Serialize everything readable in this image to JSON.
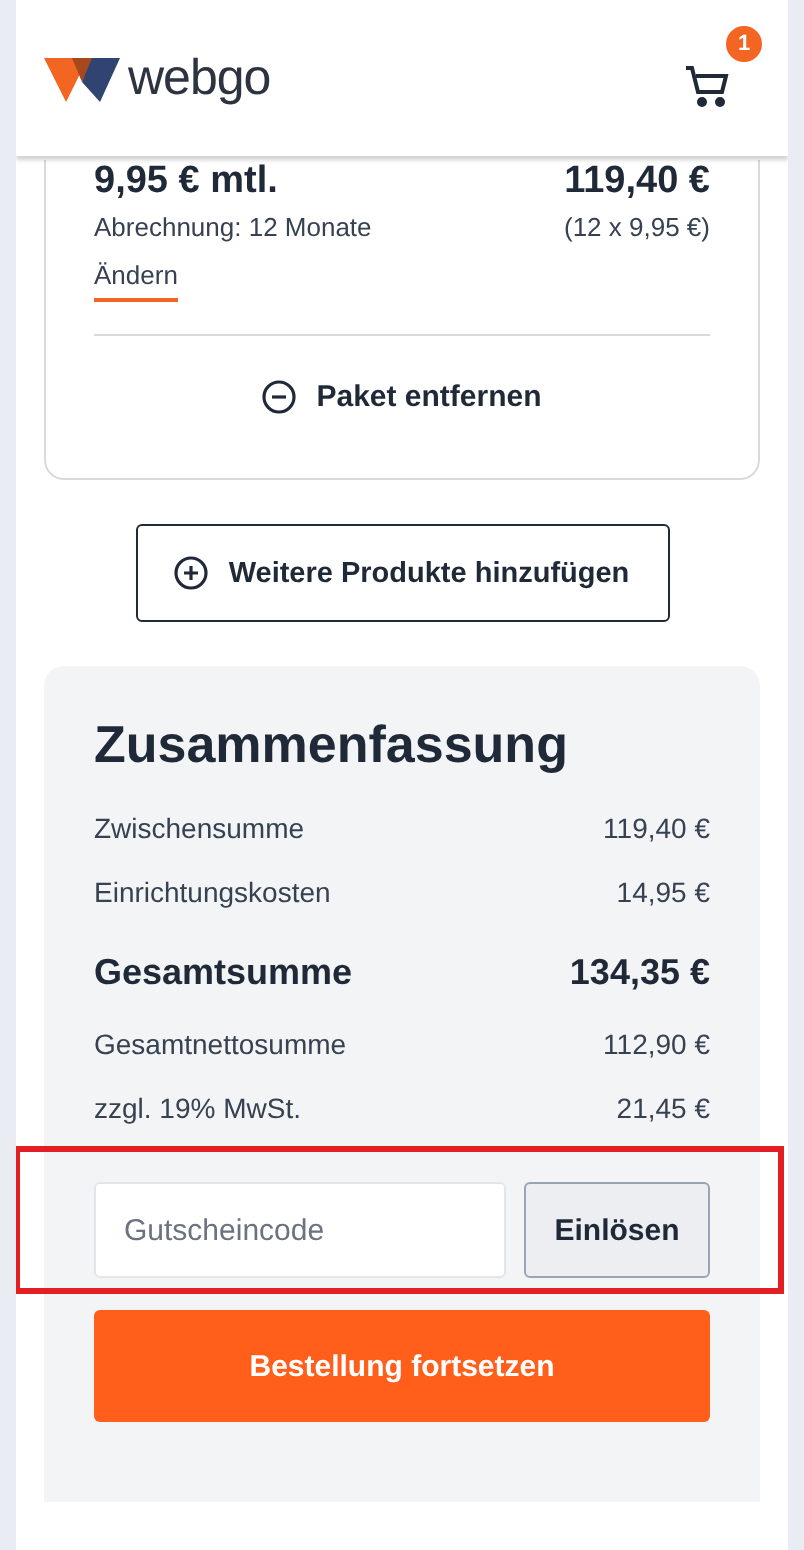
{
  "header": {
    "logo_text": "webgo",
    "cart_count": "1"
  },
  "product": {
    "price_monthly": "9,95 € mtl.",
    "total": "119,40 €",
    "billing": "Abrechnung: 12 Monate",
    "breakdown": "(12 x 9,95 €)",
    "change_link": "Ändern",
    "remove_button": "Paket entfernen"
  },
  "add_products_button": "Weitere Produkte hinzufügen",
  "summary": {
    "title": "Zusammenfassung",
    "rows": [
      {
        "label": "Zwischensumme",
        "value": "119,40 €",
        "kind": "normal"
      },
      {
        "label": "Einrichtungskosten",
        "value": "14,95 €",
        "kind": "normal"
      },
      {
        "label": "Gesamtsumme",
        "value": "134,35 €",
        "kind": "total"
      },
      {
        "label": "Gesamtnettosumme",
        "value": "112,90 €",
        "kind": "normal"
      },
      {
        "label": "zzgl. 19% MwSt.",
        "value": "21,45 €",
        "kind": "normal"
      }
    ],
    "voucher": {
      "placeholder": "Gutscheincode",
      "button": "Einlösen",
      "highlighted": true
    },
    "checkout_button": "Bestellung fortsetzen"
  }
}
